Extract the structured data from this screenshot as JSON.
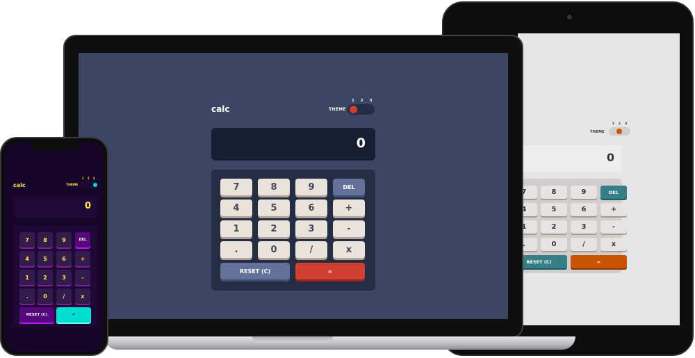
{
  "theme_numbers": [
    "1",
    "2",
    "3"
  ],
  "laptop": {
    "title": "calc",
    "theme_label": "THEME",
    "display_value": "0",
    "colors": {
      "background": "#3a4663",
      "keypad": "#242d44",
      "accent": "#d03f2f"
    },
    "keys": [
      "7",
      "8",
      "9",
      "DEL",
      "4",
      "5",
      "6",
      "+",
      "1",
      "2",
      "3",
      "-",
      ".",
      "0",
      "/",
      "x"
    ],
    "reset_label": "RESET (C)",
    "equals_label": "="
  },
  "tablet": {
    "theme_label": "THEME",
    "display_value": "0",
    "colors": {
      "background": "#e6e6e6",
      "keypad": "#d2cdcd",
      "accent": "#c85402"
    },
    "keys": [
      "7",
      "8",
      "9",
      "DEL",
      "4",
      "5",
      "6",
      "+",
      "1",
      "2",
      "3",
      "-",
      ".",
      "0",
      "/",
      "x"
    ],
    "reset_label": "RESET (C)",
    "equals_label": "="
  },
  "phone": {
    "title": "calc",
    "theme_label": "THEME",
    "display_value": "0",
    "colors": {
      "background": "#17062a",
      "keypad": "#1e0936",
      "accent": "#00e0d1"
    },
    "keys": [
      "7",
      "8",
      "9",
      "DEL",
      "4",
      "5",
      "6",
      "+",
      "1",
      "2",
      "3",
      "-",
      ".",
      "0",
      "/",
      "x"
    ],
    "reset_label": "RESET (C)",
    "equals_label": "="
  }
}
